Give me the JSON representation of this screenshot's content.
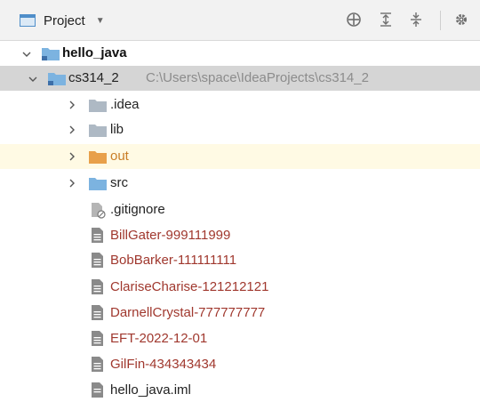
{
  "toolbar": {
    "title": "Project",
    "dropdown_glyph": "▼",
    "icons": [
      "crosshair-icon",
      "expand-all-icon",
      "collapse-all-icon",
      "gear-icon"
    ]
  },
  "tree": {
    "root": {
      "label": "hello_java"
    },
    "module": {
      "label": "cs314_2",
      "path": "C:\\Users\\space\\IdeaProjects\\cs314_2"
    },
    "folders": [
      {
        "label": ".idea"
      },
      {
        "label": "lib"
      },
      {
        "label": "out"
      },
      {
        "label": "src"
      }
    ],
    "files": [
      {
        "label": ".gitignore"
      },
      {
        "label": "BillGater-999111999"
      },
      {
        "label": "BobBarker-111111111"
      },
      {
        "label": "ClariseCharise-121212121"
      },
      {
        "label": "DarnellCrystal-777777777"
      },
      {
        "label": "EFT-2022-12-01"
      },
      {
        "label": "GilFin-434343434"
      },
      {
        "label": "hello_java.iml"
      }
    ]
  },
  "colors": {
    "selection": "#d5d5d5",
    "excluded_row": "#fffae4",
    "folder_blue": "#7cb3e0",
    "folder_gray": "#aeb9c4",
    "folder_orange": "#e8a04a",
    "text_brown": "#a0382e",
    "path_gray": "#8c8c8c"
  }
}
